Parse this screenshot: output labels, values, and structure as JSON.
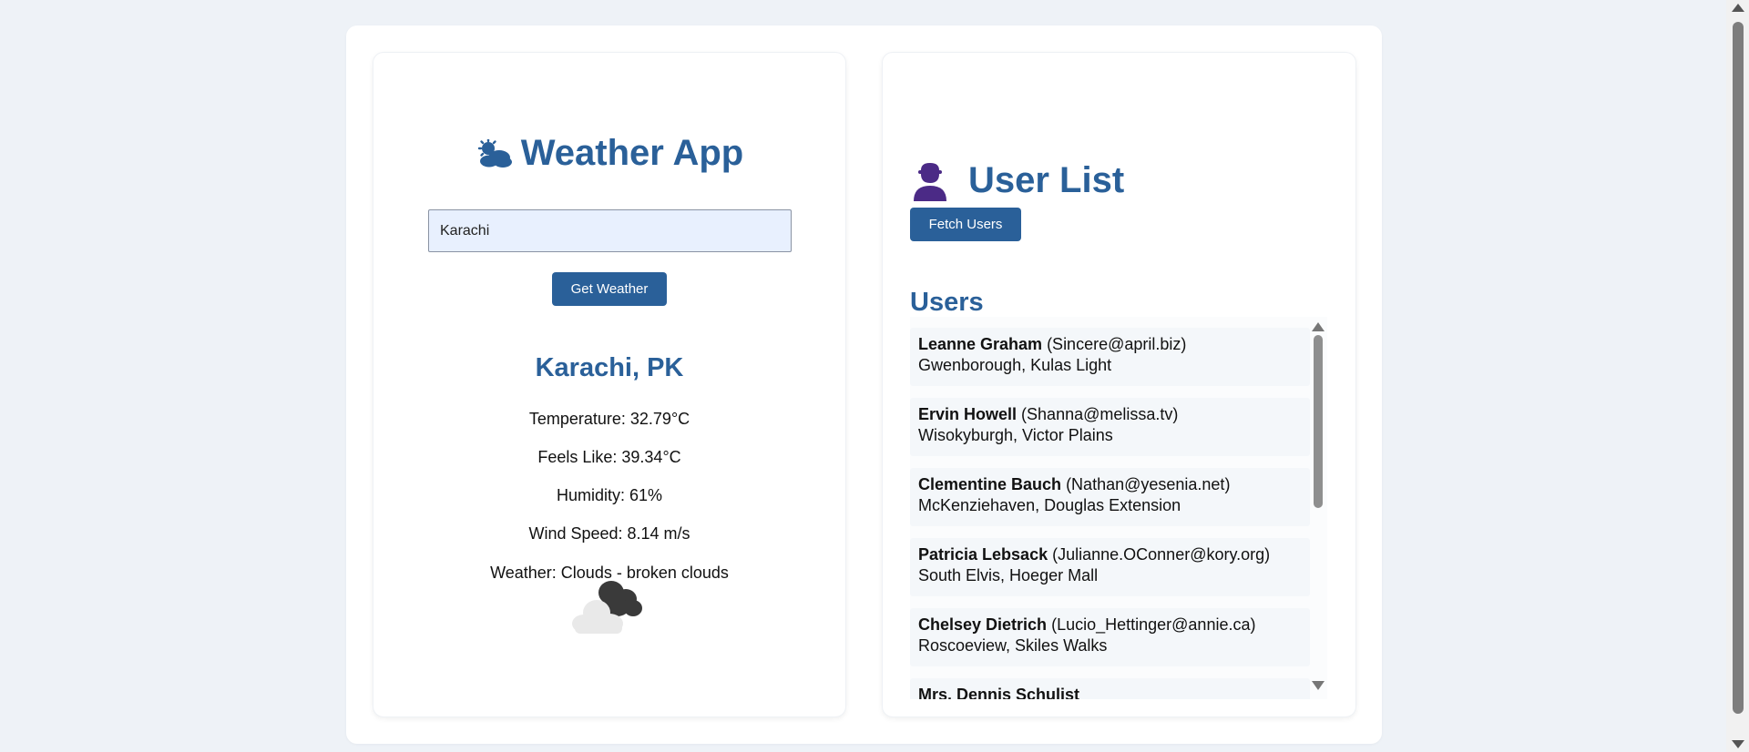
{
  "weather": {
    "title": "Weather App",
    "title_icon": "sun-behind-cloud-icon",
    "city_input_value": "Karachi",
    "get_weather_label": "Get Weather",
    "location": "Karachi, PK",
    "temperature": "Temperature: 32.79°C",
    "feels_like": "Feels Like: 39.34°C",
    "humidity": "Humidity: 61%",
    "wind_speed": "Wind Speed: 8.14 m/s",
    "description": "Weather: Clouds - broken clouds",
    "condition_icon": "broken-clouds-icon"
  },
  "users": {
    "title": "User List",
    "title_icon": "user-silhouette-icon",
    "fetch_label": "Fetch Users",
    "heading": "Users",
    "items": [
      {
        "name": "Leanne Graham",
        "email": "(Sincere@april.biz)",
        "address": "Gwenborough, Kulas Light"
      },
      {
        "name": "Ervin Howell",
        "email": "(Shanna@melissa.tv)",
        "address": "Wisokyburgh, Victor Plains"
      },
      {
        "name": "Clementine Bauch",
        "email": "(Nathan@yesenia.net)",
        "address": "McKenziehaven, Douglas Extension"
      },
      {
        "name": "Patricia Lebsack",
        "email": "(Julianne.OConner@kory.org)",
        "address": "South Elvis, Hoeger Mall"
      },
      {
        "name": "Chelsey Dietrich",
        "email": "(Lucio_Hettinger@annie.ca)",
        "address": "Roscoeview, Skiles Walks"
      },
      {
        "name": "Mrs. Dennis Schulist",
        "email": "",
        "address": ""
      }
    ]
  },
  "colors": {
    "accent": "#2a6099",
    "page_background": "#eef2f7",
    "input_background": "#e8f0fe"
  }
}
